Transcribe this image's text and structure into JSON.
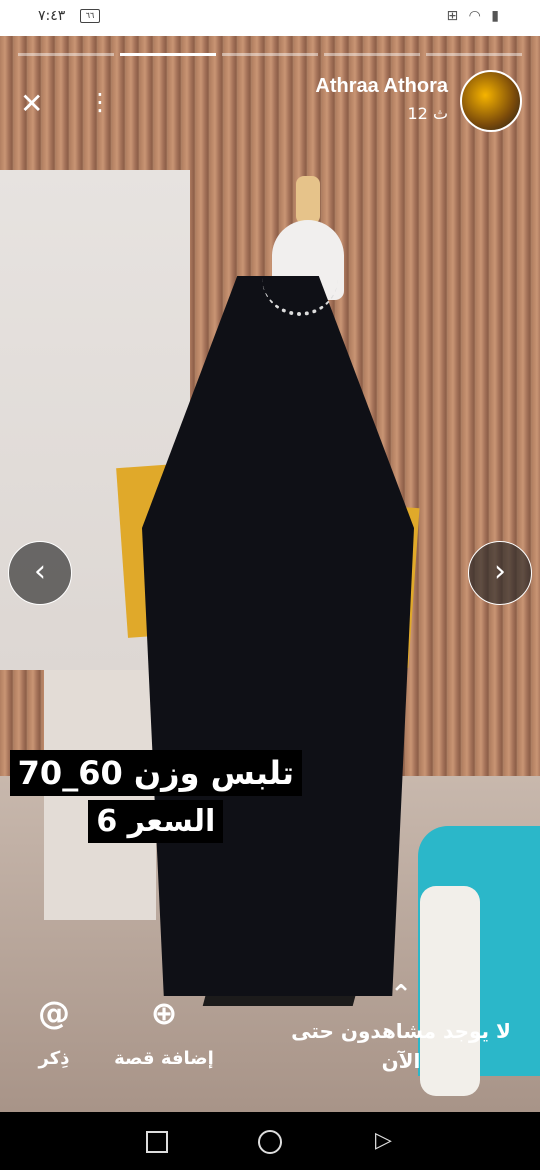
{
  "status_bar": {
    "time": "٧:٤٣",
    "battery": "٦٦",
    "right_icons": "⊞ ◠ ▮"
  },
  "story": {
    "progress_segments": 5,
    "progress_done_index": 1,
    "author_name": "Athraa Athora",
    "time_ago": "12 ث",
    "caption_line1": "تلبس وزن 60_70",
    "caption_line2": "السعر 6"
  },
  "controls": {
    "close": "✕",
    "more": "⋮",
    "prev": "‹",
    "next": "›"
  },
  "bottom_actions": {
    "mention_icon": "@",
    "mention_label": "ذِكر",
    "add_story_icon": "⊕",
    "add_story_label": "إضافة قصة",
    "viewers_icon": "⌃",
    "viewers_text": "لا يوجد مشاهدون حتى الآن"
  },
  "system_nav": {
    "back": "▷"
  }
}
